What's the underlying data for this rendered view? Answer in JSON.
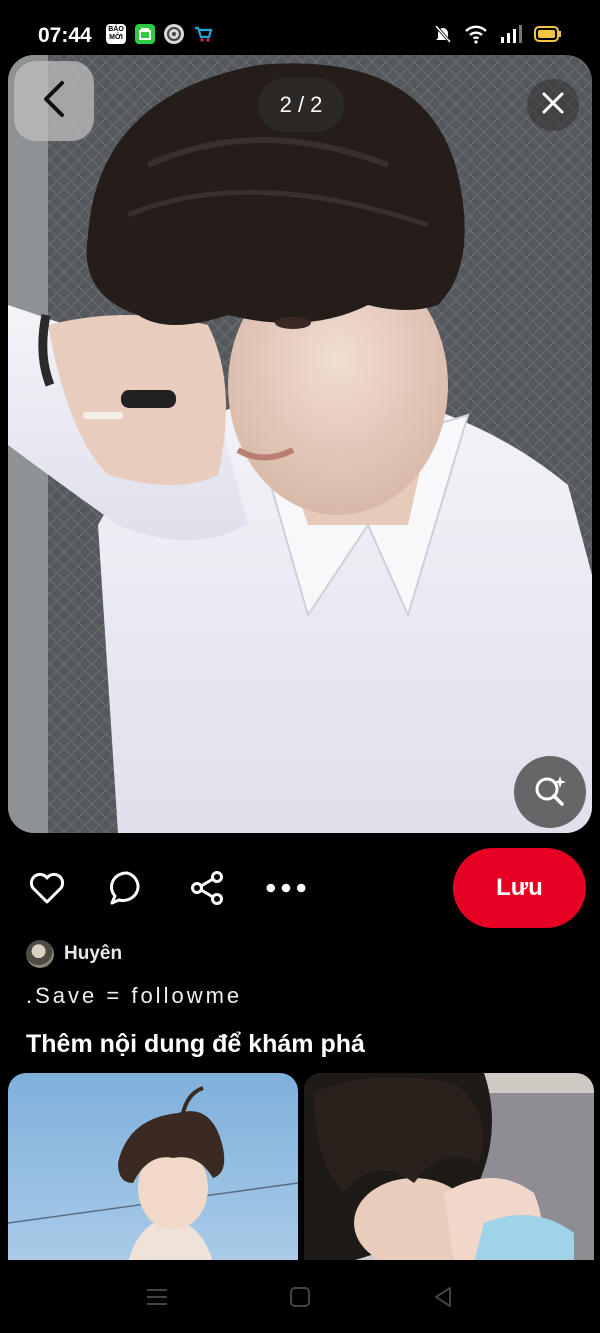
{
  "status_bar": {
    "time": "07:44",
    "notification_icons": [
      {
        "name": "bao-moi-app-icon",
        "text": "BÁO MỚI",
        "color": "#ffffff"
      },
      {
        "name": "shopping-app-icon",
        "color": "#2ecc40"
      },
      {
        "name": "compass-app-icon",
        "color": "#d8d8d8"
      },
      {
        "name": "cart-app-icon",
        "color": "#21a6d6"
      }
    ],
    "system_icons": [
      "mute-bell-icon",
      "wifi-icon",
      "signal-icon",
      "battery-icon"
    ],
    "battery_color": "#f5c542"
  },
  "viewer": {
    "page_counter": "2 / 2",
    "icons": {
      "back": "chevron-left-icon",
      "close": "close-icon",
      "lens": "visual-search-icon"
    }
  },
  "actions": {
    "icons": [
      "heart-icon",
      "comment-icon",
      "share-icon",
      "more-icon"
    ],
    "save_label": "Lưu",
    "save_color": "#e60023"
  },
  "pin": {
    "author": "Huyên",
    "caption": ".Save = followme"
  },
  "more_section": {
    "title": "Thêm nội dung để khám phá"
  },
  "nav_bar": {
    "icons": [
      "menu-icon",
      "home-square-icon",
      "back-triangle-icon"
    ]
  }
}
